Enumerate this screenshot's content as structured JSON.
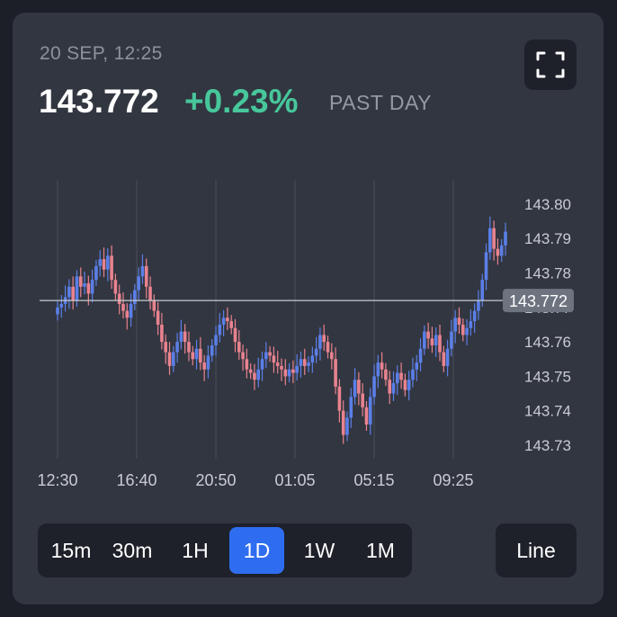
{
  "header": {
    "timestamp": "20 SEP, 12:25",
    "price": "143.772",
    "change": "+0.23%",
    "period": "PAST DAY"
  },
  "expand_icon": "fullscreen-icon",
  "range": {
    "options": [
      "15m",
      "30m",
      "1H",
      "1D",
      "1W",
      "1M"
    ],
    "selected": "1D"
  },
  "chart_mode_label": "Line",
  "colors": {
    "background": "#1c1f27",
    "card": "#323640",
    "positive": "#47c79b",
    "accent": "#2f6df0",
    "candle_up": "#5b7fe8",
    "candle_down": "#e8838f"
  },
  "chart_data": {
    "type": "candlestick",
    "title": "",
    "xlabel": "",
    "ylabel": "",
    "ylim": [
      143.727,
      143.803
    ],
    "y_ticks": [
      143.73,
      143.74,
      143.75,
      143.76,
      143.77,
      143.78,
      143.79,
      143.8
    ],
    "y_tick_labels": [
      "143.73",
      "143.74",
      "143.75",
      "143.76",
      "143.77",
      "143.78",
      "143.79",
      "143.80"
    ],
    "x_tick_labels": [
      "12:30",
      "16:40",
      "20:50",
      "01:05",
      "05:15",
      "09:25"
    ],
    "grid": "vertical",
    "current_price": 143.772,
    "current_price_label": "143.772",
    "series": [
      {
        "values": [
          143.77,
          143.771,
          143.773,
          143.776,
          143.772,
          143.779,
          143.776,
          143.777,
          143.774,
          143.778,
          143.782,
          143.784,
          143.781,
          143.785,
          143.778,
          143.774,
          143.771,
          143.769,
          143.767,
          143.771,
          143.775,
          143.779,
          143.782,
          143.776,
          143.772,
          143.769,
          143.765,
          143.76,
          143.757,
          143.753,
          143.757,
          143.76,
          143.763,
          143.76,
          143.757,
          143.755,
          143.758,
          143.754,
          143.752,
          143.756,
          143.759,
          143.762,
          143.765,
          143.767,
          143.766,
          143.764,
          143.76,
          143.757,
          143.755,
          143.752,
          143.751,
          143.749,
          143.752,
          143.755,
          143.757,
          143.756,
          143.754,
          143.753,
          143.752,
          143.75,
          143.752,
          143.751,
          143.753,
          143.755,
          143.753,
          143.754,
          143.756,
          143.758,
          143.762,
          143.76,
          143.757,
          143.755,
          143.747,
          143.74,
          143.733,
          143.738,
          143.744,
          143.749,
          143.745,
          143.741,
          143.736,
          143.744,
          143.75,
          143.754,
          143.752,
          143.749,
          143.745,
          143.748,
          143.751,
          143.749,
          143.746,
          143.749,
          143.752,
          143.754,
          143.758,
          143.763,
          143.761,
          143.759,
          143.762,
          143.757,
          143.753,
          143.758,
          143.763,
          143.767,
          143.765,
          143.762,
          143.764,
          143.766,
          143.769,
          143.772,
          143.778,
          143.786,
          143.793,
          143.787,
          143.785,
          143.788,
          143.792
        ]
      }
    ]
  }
}
